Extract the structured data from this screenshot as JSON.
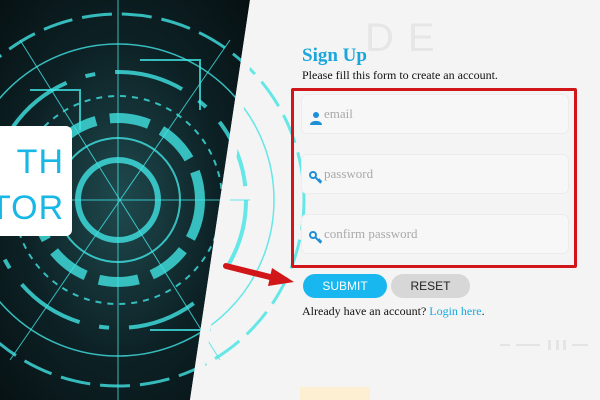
{
  "hero": {
    "logo_line1": "TH",
    "logo_line2": "TOR"
  },
  "background": {
    "watermark": "DE"
  },
  "form": {
    "title": "Sign Up",
    "subtitle": "Please fill this form to create an account.",
    "fields": [
      {
        "placeholder": "email",
        "icon": "user-icon"
      },
      {
        "placeholder": "password",
        "icon": "key-icon"
      },
      {
        "placeholder": "confirm password",
        "icon": "key-icon"
      }
    ],
    "submit_label": "SUBMIT",
    "reset_label": "RESET",
    "login_prompt": "Already have an account?",
    "login_link": "Login here",
    "login_suffix": "."
  },
  "colors": {
    "accent": "#18b7ef",
    "title": "#1ba6db",
    "highlight": "#d01619",
    "reset_bg": "#d7d7d7",
    "hero_bg": "#0b1a1f",
    "hero_glow": "#41e3e3"
  }
}
